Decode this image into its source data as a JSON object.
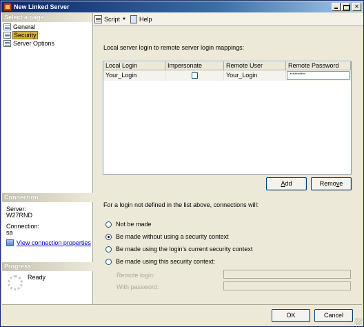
{
  "window": {
    "title": "New Linked Server"
  },
  "sidebar": {
    "select_page_header": "Select a page",
    "pages": [
      {
        "label": "General"
      },
      {
        "label": "Security"
      },
      {
        "label": "Server Options"
      }
    ],
    "connection": {
      "header": "Connection",
      "server_label": "Server:",
      "server_value": "W27RND",
      "connection_label": "Connection:",
      "connection_value": "sa",
      "view_properties_link": "View connection properties"
    },
    "progress": {
      "header": "Progress",
      "status": "Ready"
    }
  },
  "toolbar": {
    "script_label": "Script",
    "help_label": "Help"
  },
  "main": {
    "mapping_label": "Local server login to remote server login mappings:",
    "grid": {
      "columns": [
        "Local Login",
        "Impersonate",
        "Remote User",
        "Remote Password"
      ],
      "rows": [
        {
          "local_login": "Your_Login",
          "impersonate": false,
          "remote_user": "Your_Login",
          "remote_password": "**********"
        }
      ]
    },
    "add_button": {
      "pre": "",
      "mnemonic": "A",
      "post": "dd"
    },
    "remove_button": {
      "pre": "Remo",
      "mnemonic": "v",
      "post": "e"
    },
    "undefined_login_label": "For a login not defined in the list above, connections will:",
    "options": [
      {
        "label": "Not be made",
        "checked": false
      },
      {
        "label": "Be made without using a security context",
        "checked": true
      },
      {
        "label": "Be made using the login's current security context",
        "checked": false
      },
      {
        "label": "Be made using this security context:",
        "checked": false
      }
    ],
    "remote_login_label": "Remote login:",
    "remote_login_value": "",
    "with_password_label": "With password:",
    "with_password_value": ""
  },
  "footer": {
    "ok_label": "OK",
    "cancel_label": "Cancel"
  }
}
